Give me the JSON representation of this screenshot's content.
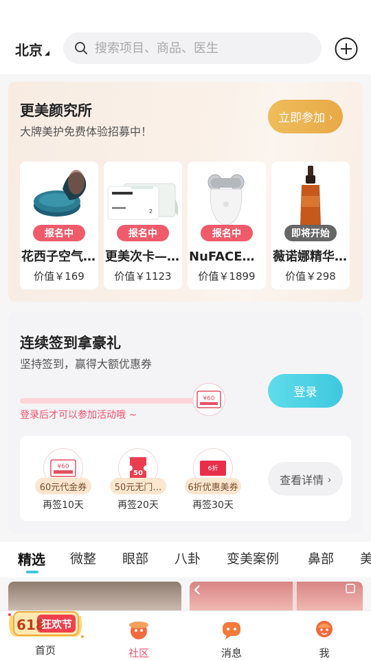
{
  "header": {
    "city": "北京",
    "search_placeholder": "搜索项目、商品、医生",
    "add_icon": "plus-circle-icon"
  },
  "lab": {
    "title": "更美颜究所",
    "subtitle": "大牌美护免费体验招募中！",
    "join_label": "立即参加",
    "products": [
      {
        "name": "花西子空气…",
        "price": "价值￥169",
        "badge": "报名中",
        "badge_color": "#f05b6b"
      },
      {
        "name": "更美次卡—…",
        "price": "价值￥1123",
        "badge": "报名中",
        "badge_color": "#f05b6b"
      },
      {
        "name": "NuFACE美…",
        "price": "价值￥1899",
        "badge": "报名中",
        "badge_color": "#f05b6b"
      },
      {
        "name": "薇诺娜精华…",
        "price": "价值￥298",
        "badge": "即将开始",
        "badge_color": "#666666"
      }
    ]
  },
  "signin": {
    "title": "连续签到拿豪礼",
    "subtitle": "坚持签到，赢得大额优惠券",
    "hint": "登录后才可以参加活动哦 ~",
    "login_label": "登录",
    "progress_coupon_value": "¥60",
    "rewards": [
      {
        "label": "60元代金券",
        "days": "再签10天",
        "icon_text": "¥60"
      },
      {
        "label": "50元无门…",
        "days": "再签20天",
        "icon_text": "50"
      },
      {
        "label": "6折优惠美券",
        "days": "再签30天",
        "icon_text": "6折"
      }
    ],
    "detail_label": "查看详情"
  },
  "tabs": {
    "items": [
      "精选",
      "微整",
      "眼部",
      "八卦",
      "变美案例",
      "鼻部",
      "美"
    ],
    "active": "精选"
  },
  "nav": {
    "items": [
      {
        "label": "首页"
      },
      {
        "label": "社区"
      },
      {
        "label": "消息"
      },
      {
        "label": "我"
      }
    ],
    "promo_text": "618",
    "promo_sub": "狂欢节",
    "active": "社区"
  },
  "colors": {
    "accent": "#3cc8de",
    "highlight": "#f0516a",
    "gold": "#e9a948"
  }
}
